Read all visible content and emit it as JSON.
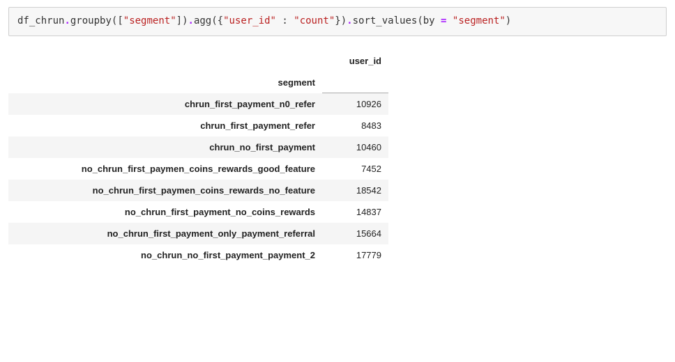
{
  "code": {
    "t0": "df_chrun",
    "t1": ".",
    "t2": "groupby",
    "t3": "(",
    "t4": "[",
    "t5": "\"segment\"",
    "t6": "]",
    "t7": ")",
    "t8": ".",
    "t9": "agg",
    "t10": "(",
    "t11": "{",
    "t12": "\"user_id\"",
    "t13": " : ",
    "t14": "\"count\"",
    "t15": "}",
    "t16": ")",
    "t17": ".",
    "t18": "sort_values",
    "t19": "(",
    "t20": "by",
    "t21": " ",
    "t22": "=",
    "t23": " ",
    "t24": "\"segment\"",
    "t25": ")"
  },
  "table": {
    "column_header": "user_id",
    "index_name": "segment",
    "rows": [
      {
        "segment": "chrun_first_payment_n0_refer",
        "user_id": "10926"
      },
      {
        "segment": "chrun_first_payment_refer",
        "user_id": "8483"
      },
      {
        "segment": "chrun_no_first_payment",
        "user_id": "10460"
      },
      {
        "segment": "no_chrun_first_paymen_coins_rewards_good_feature",
        "user_id": "7452"
      },
      {
        "segment": "no_chrun_first_paymen_coins_rewards_no_feature",
        "user_id": "18542"
      },
      {
        "segment": "no_chrun_first_payment_no_coins_rewards",
        "user_id": "14837"
      },
      {
        "segment": "no_chrun_first_payment_only_payment_referral",
        "user_id": "15664"
      },
      {
        "segment": "no_chrun_no_first_payment_payment_2",
        "user_id": "17779"
      }
    ]
  }
}
